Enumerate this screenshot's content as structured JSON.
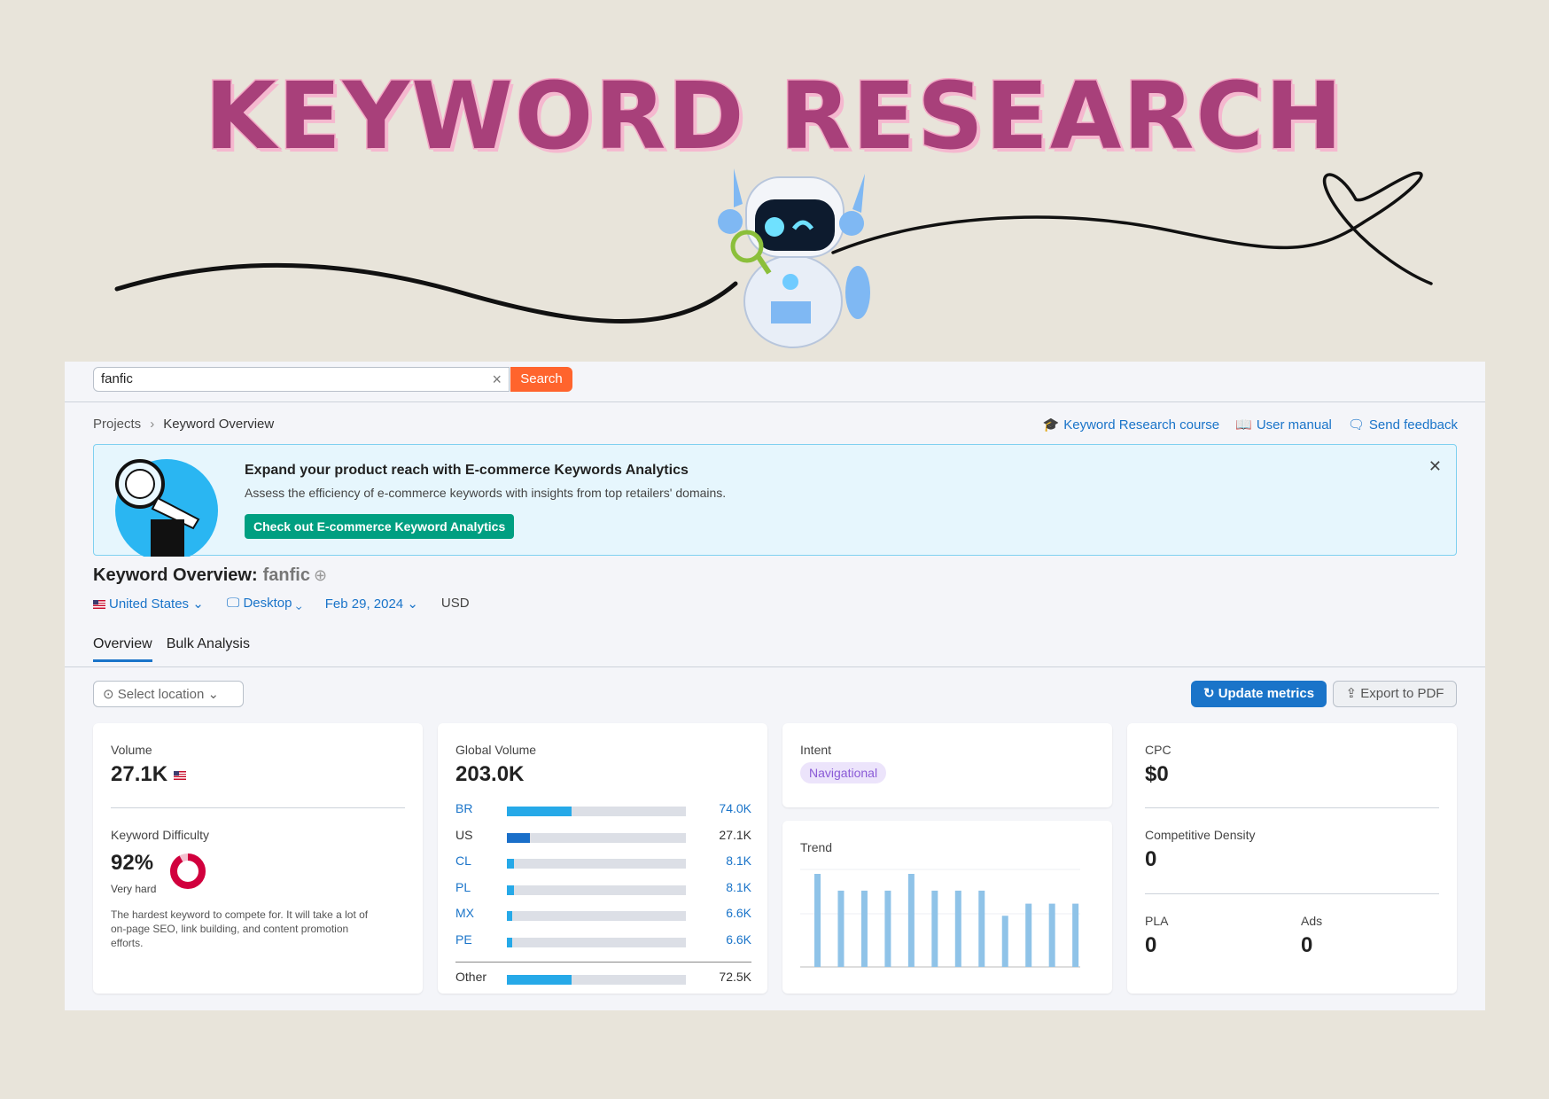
{
  "hero": {
    "title": "KEYWORD RESEARCH"
  },
  "search": {
    "value": "fanfic",
    "button": "Search"
  },
  "breadcrumb": {
    "root": "Projects",
    "current": "Keyword Overview"
  },
  "links": {
    "course": "Keyword Research course",
    "manual": "User manual",
    "feedback": "Send feedback"
  },
  "banner": {
    "title": "Expand your product reach with E-commerce Keywords Analytics",
    "subtitle": "Assess the efficiency of e-commerce keywords with insights from top retailers' domains.",
    "cta": "Check out E-commerce Keyword Analytics"
  },
  "overview": {
    "title": "Keyword Overview:",
    "keyword": "fanfic"
  },
  "filters": {
    "country": "United States",
    "device": "Desktop",
    "date": "Feb 29, 2024",
    "currency": "USD"
  },
  "tabs": [
    "Overview",
    "Bulk Analysis"
  ],
  "controls": {
    "location_placeholder": "Select location",
    "update": "Update metrics",
    "export": "Export to PDF"
  },
  "volume": {
    "label": "Volume",
    "value": "27.1K"
  },
  "difficulty": {
    "label": "Keyword Difficulty",
    "value": "92%",
    "level": "Very hard",
    "percent": 92,
    "desc_line1": "The hardest keyword to compete for. It will take a lot of",
    "desc_line2": "on-page SEO, link building, and content promotion",
    "desc_line3": "efforts."
  },
  "global_volume": {
    "label": "Global Volume",
    "value": "203.0K",
    "rows": [
      {
        "code": "BR",
        "value": "74.0K",
        "share": 0.36
      },
      {
        "code": "US",
        "value": "27.1K",
        "share": 0.13
      },
      {
        "code": "CL",
        "value": "8.1K",
        "share": 0.04
      },
      {
        "code": "PL",
        "value": "8.1K",
        "share": 0.04
      },
      {
        "code": "MX",
        "value": "6.6K",
        "share": 0.03
      },
      {
        "code": "PE",
        "value": "6.6K",
        "share": 0.03
      }
    ],
    "other": {
      "code": "Other",
      "value": "72.5K",
      "share": 0.36
    }
  },
  "intent": {
    "label": "Intent",
    "value": "Navigational"
  },
  "trend": {
    "label": "Trend",
    "values": [
      100,
      82,
      82,
      82,
      100,
      82,
      82,
      82,
      55,
      68,
      68,
      68
    ]
  },
  "cpc": {
    "label": "CPC",
    "value": "$0"
  },
  "density": {
    "label": "Competitive Density",
    "value": "0"
  },
  "pla": {
    "label": "PLA",
    "value": "0"
  },
  "ads": {
    "label": "Ads",
    "value": "0"
  },
  "colors": {
    "accent": "#1a74c9",
    "search": "#ff642d",
    "cta": "#009f81",
    "difficulty": "#d1003d",
    "trend": "#8fc3e8"
  }
}
